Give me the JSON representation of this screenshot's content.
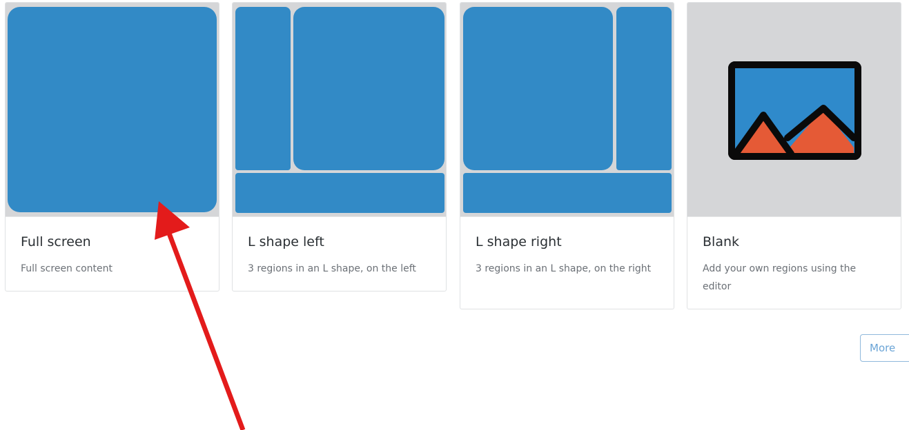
{
  "templates": [
    {
      "title": "Full screen",
      "description": "Full screen content"
    },
    {
      "title": "L shape left",
      "description": "3 regions in an L shape, on the left"
    },
    {
      "title": "L shape right",
      "description": "3 regions in an L shape, on the right"
    },
    {
      "title": "Blank",
      "description": "Add your own regions using the editor",
      "icon": "image-placeholder-icon"
    }
  ],
  "more_label": "More",
  "colors": {
    "region": "#328ac6",
    "preview_bg": "#d5d6d8",
    "image_icon_sky": "#2f8acb",
    "image_icon_mountain": "#e55a36",
    "arrow": "#e31b1b"
  }
}
